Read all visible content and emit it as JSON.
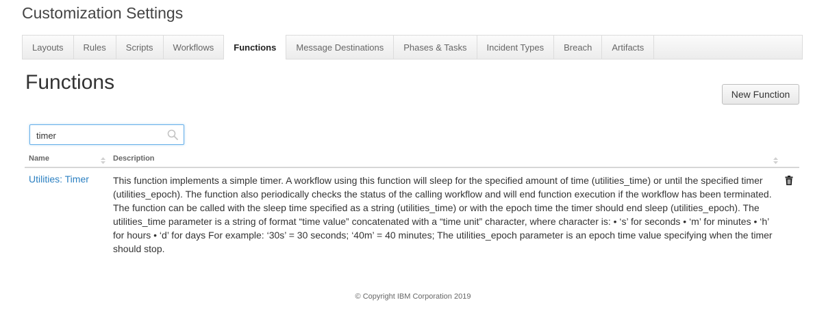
{
  "page": {
    "title": "Customization Settings"
  },
  "tabs": [
    {
      "label": "Layouts",
      "active": false
    },
    {
      "label": "Rules",
      "active": false
    },
    {
      "label": "Scripts",
      "active": false
    },
    {
      "label": "Workflows",
      "active": false
    },
    {
      "label": "Functions",
      "active": true
    },
    {
      "label": "Message Destinations",
      "active": false
    },
    {
      "label": "Phases & Tasks",
      "active": false
    },
    {
      "label": "Incident Types",
      "active": false
    },
    {
      "label": "Breach",
      "active": false
    },
    {
      "label": "Artifacts",
      "active": false
    }
  ],
  "section": {
    "title": "Functions",
    "new_button_label": "New Function"
  },
  "search": {
    "value": "timer",
    "icon": "search-icon"
  },
  "table": {
    "columns": [
      "Name",
      "Description"
    ],
    "rows": [
      {
        "name": "Utilities: Timer",
        "description": "This function implements a simple timer. A workflow using this function will sleep for the specified amount of time (utilities_time) or until the specified timer (utilities_epoch). The function also periodically checks the status of the calling workflow and will end function execution if the workflow has been terminated. The function can be called with the sleep time specified as a string (utilities_time) or with the epoch time the timer should end sleep (utilities_epoch). The utilities_time parameter is a string of format “time value” concatenated with a “time unit” character, where character is: • ‘s’ for seconds • ‘m’ for minutes • ‘h’ for hours • ‘d’ for days For example: ‘30s’ = 30 seconds; ‘40m’ = 40 minutes; The utilities_epoch parameter is an epoch time value specifying when the timer should stop.",
        "action_icon": "trash-icon"
      }
    ]
  },
  "footer": {
    "copyright": "© Copyright IBM Corporation 2019"
  },
  "colors": {
    "link": "#2a7fc1",
    "focus_border": "#66afe9"
  }
}
